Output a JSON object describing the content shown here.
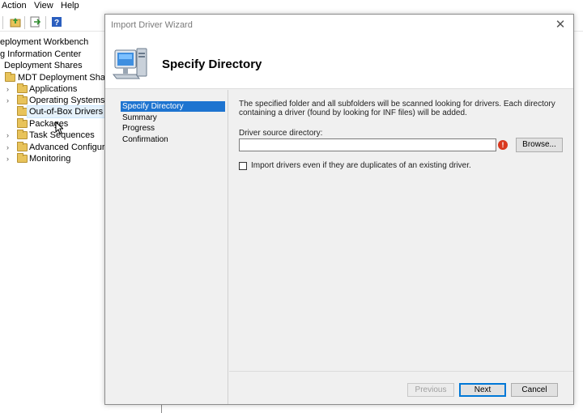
{
  "menu": {
    "items": [
      "Action",
      "View",
      "Help"
    ]
  },
  "tree": {
    "root": "eployment Workbench",
    "info_center": "g Information Center",
    "deployment_shares": "Deployment Shares",
    "share": "MDT Deployment Share (C",
    "children": [
      {
        "label": "Applications"
      },
      {
        "label": "Operating Systems"
      },
      {
        "label": "Out-of-Box Drivers"
      },
      {
        "label": "Packages"
      },
      {
        "label": "Task Sequences"
      },
      {
        "label": "Advanced Configurati"
      },
      {
        "label": "Monitoring"
      }
    ]
  },
  "dialog": {
    "title": "Import Driver Wizard",
    "heading": "Specify Directory",
    "steps": [
      "Specify Directory",
      "Summary",
      "Progress",
      "Confirmation"
    ],
    "active_step": "Specify Directory",
    "description": "The specified folder and all subfolders will be scanned looking for drivers.  Each directory containing a driver (found by looking for INF files) will be added.",
    "source_label": "Driver source directory:",
    "source_value": "",
    "error_icon": "!",
    "browse_label": "Browse...",
    "checkbox_label": "Import drivers even if they are duplicates of an existing driver.",
    "checkbox_checked": false,
    "buttons": {
      "previous": "Previous",
      "next": "Next",
      "cancel": "Cancel"
    }
  }
}
